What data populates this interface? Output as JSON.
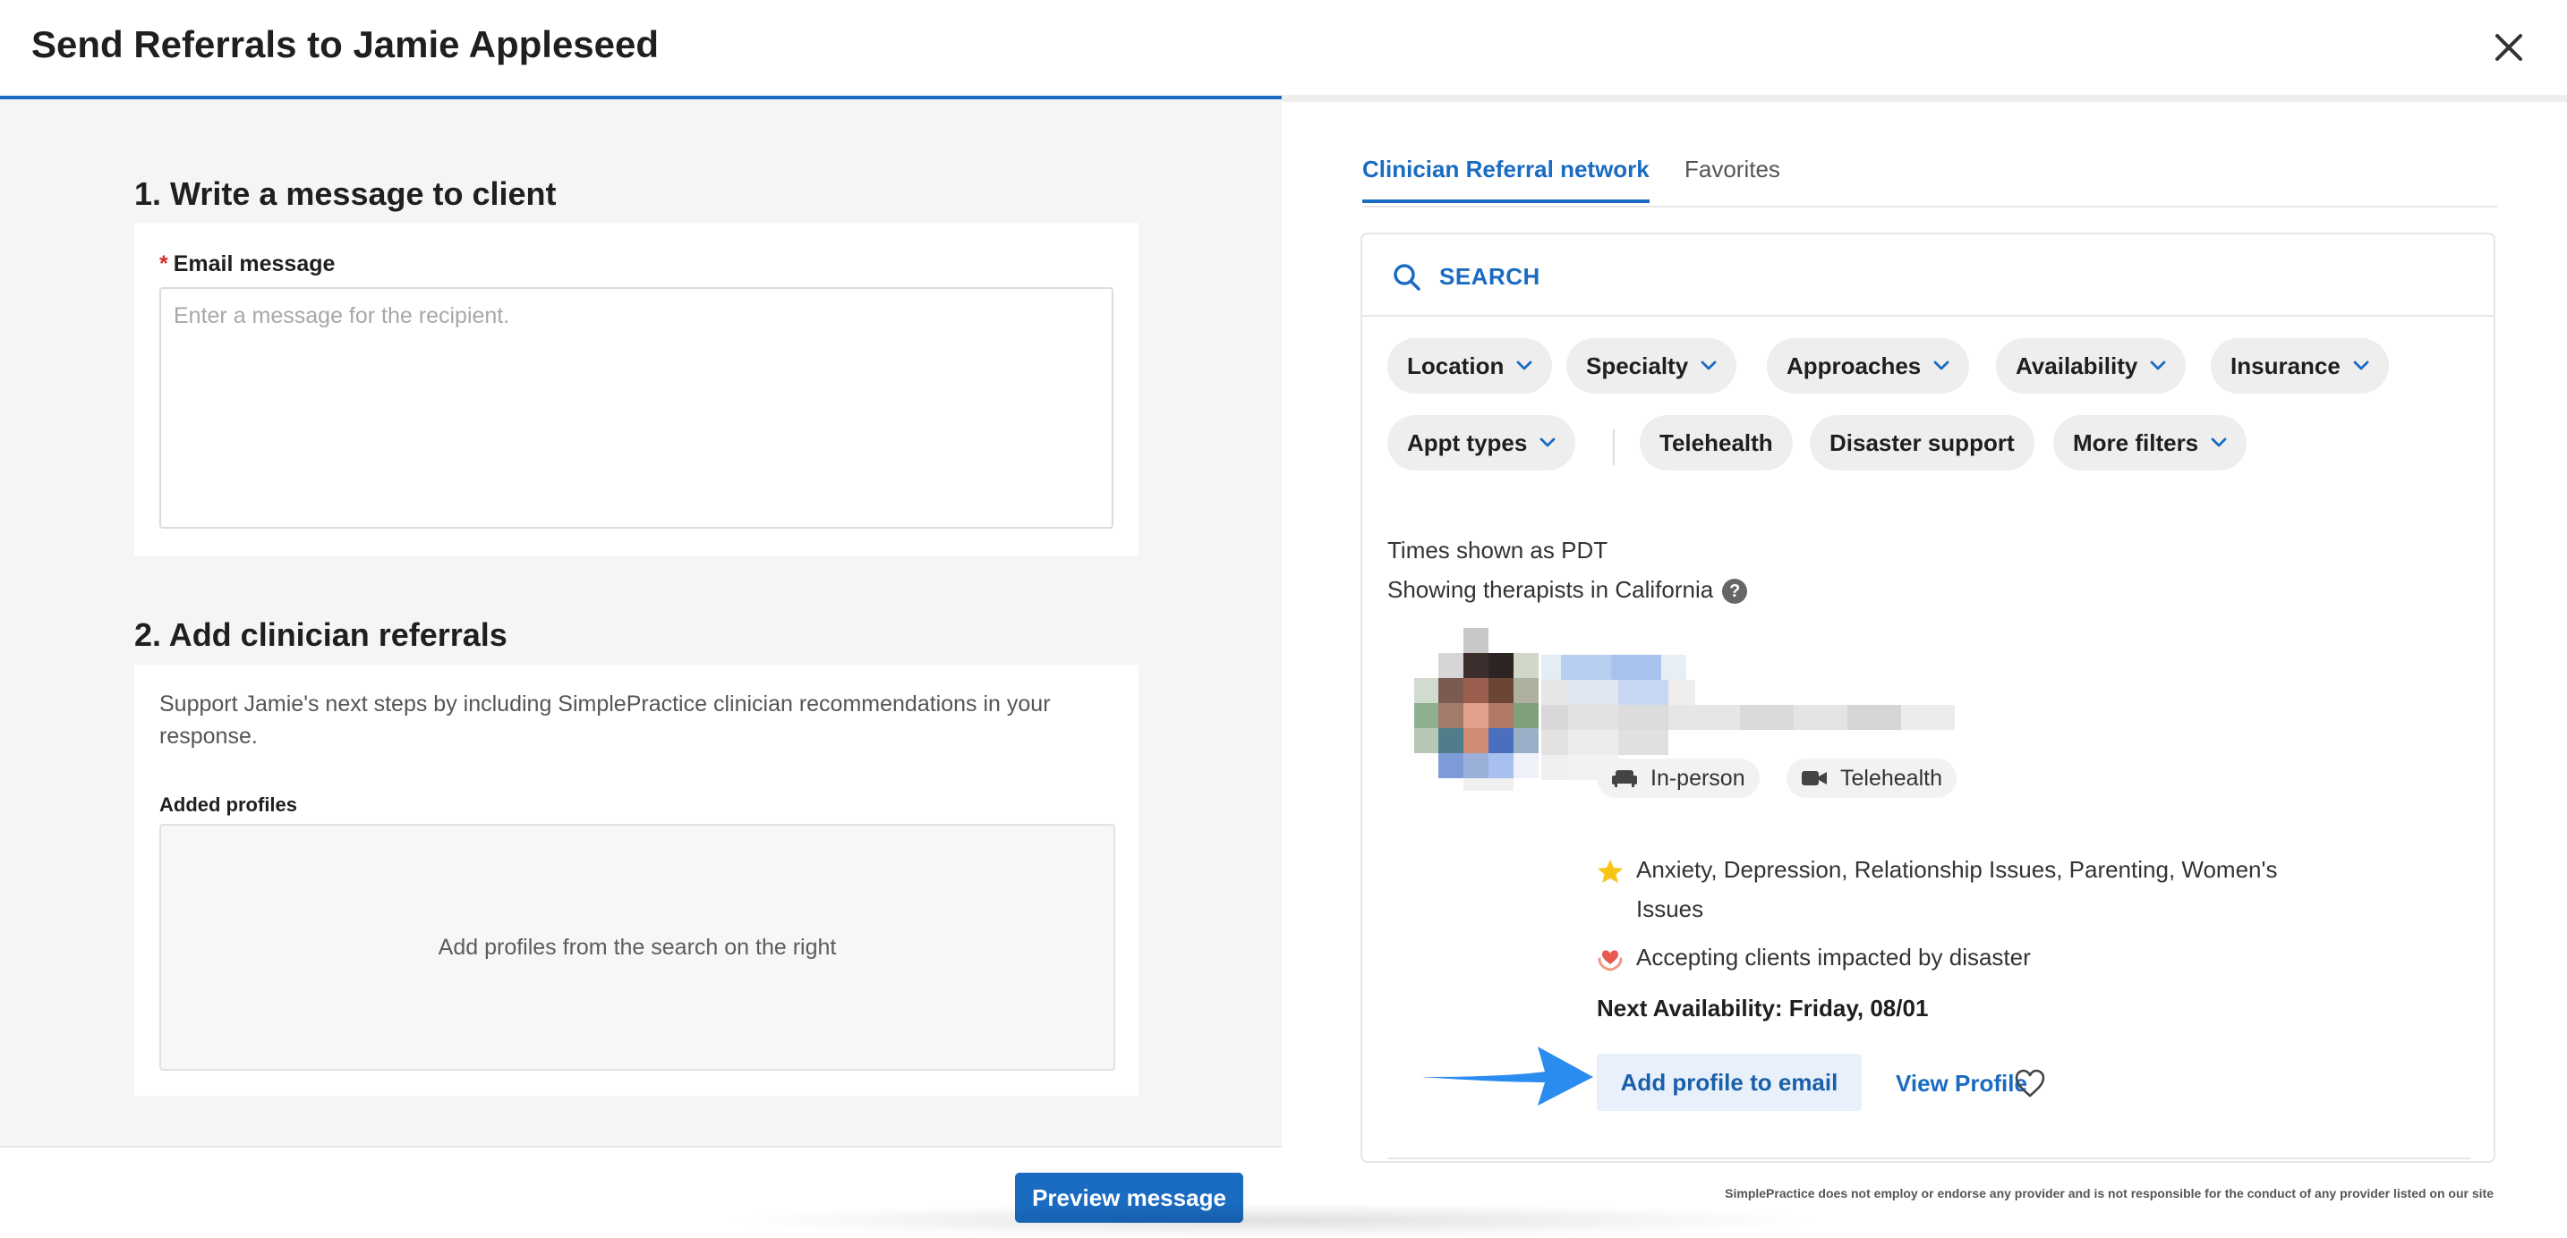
{
  "header": {
    "title": "Send Referrals to Jamie Appleseed"
  },
  "step1": {
    "title": "1. Write a message to client",
    "required_mark": "*",
    "field_label": "Email message",
    "placeholder": "Enter a message for the recipient.",
    "value": ""
  },
  "step2": {
    "title": "2. Add clinician referrals",
    "description": "Support Jamie's next steps by including SimplePractice clinician recommendations in your response.",
    "added_label": "Added profiles",
    "dropzone_text": "Add profiles from the search on the right"
  },
  "footer": {
    "preview_label": "Preview message"
  },
  "tabs": [
    {
      "label": "Clinician Referral network",
      "active": true
    },
    {
      "label": "Favorites",
      "active": false
    }
  ],
  "search": {
    "label": "SEARCH"
  },
  "filters": {
    "row1": [
      "Location",
      "Specialty",
      "Approaches",
      "Availability",
      "Insurance"
    ],
    "row2_dropdown": "Appt types",
    "row2_toggles": [
      "Telehealth",
      "Disaster support"
    ],
    "more": "More filters"
  },
  "info": {
    "timezone": "Times shown as PDT",
    "location": "Showing therapists in California"
  },
  "profile": {
    "modes": [
      "In-person",
      "Telehealth"
    ],
    "specialties": "Anxiety, Depression, Relationship Issues, Parenting, Women's Issues",
    "disaster": "Accepting clients impacted by disaster",
    "next_availability": "Next Availability: Friday, 08/01",
    "add_button": "Add profile to email",
    "view_link": "View Profile"
  },
  "disclaimer": "SimplePractice does not employ or endorse any provider and is not responsible for the conduct of any provider listed on our site",
  "colors": {
    "accent": "#1a6bc2",
    "arrow": "#2b8cf0",
    "star": "#f5c518",
    "disaster": "#e85a4f"
  },
  "icons": [
    "close-icon",
    "search-icon",
    "chevron-down-icon",
    "help-icon",
    "couch-icon",
    "video-icon",
    "star-icon",
    "heart-hands-icon",
    "heart-icon",
    "arrow-icon"
  ]
}
